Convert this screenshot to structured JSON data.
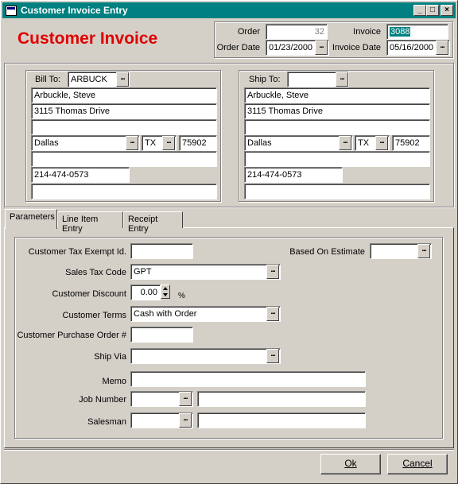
{
  "window": {
    "title": "Customer Invoice Entry"
  },
  "header": {
    "heading": "Customer Invoice",
    "order_label": "Order",
    "order_value": "32",
    "invoice_label": "Invoice",
    "invoice_value": "3088",
    "order_date_label": "Order Date",
    "order_date_value": "01/23/2000",
    "invoice_date_label": "Invoice Date",
    "invoice_date_value": "05/16/2000"
  },
  "bill_to": {
    "label": "Bill To:",
    "code": "ARBUCK",
    "name": "Arbuckle, Steve",
    "address1": "3115 Thomas Drive",
    "address2": "",
    "city": "Dallas",
    "state": "TX",
    "zip": "75902",
    "extra": "",
    "phone": "214-474-0573",
    "extra2": ""
  },
  "ship_to": {
    "label": "Ship To:",
    "code": "",
    "name": "Arbuckle, Steve",
    "address1": "3115 Thomas Drive",
    "address2": "",
    "city": "Dallas",
    "state": "TX",
    "zip": "75902",
    "extra": "",
    "phone": "214-474-0573",
    "extra2": ""
  },
  "tabs": [
    {
      "label": "Parameters"
    },
    {
      "label": "Line Item Entry"
    },
    {
      "label": "Receipt Entry"
    }
  ],
  "params": {
    "tax_exempt_label": "Customer Tax Exempt Id.",
    "tax_exempt_value": "",
    "based_on_estimate_label": "Based On Estimate",
    "based_on_estimate_value": "",
    "sales_tax_label": "Sales Tax Code",
    "sales_tax_value": "GPT",
    "discount_label": "Customer Discount",
    "discount_value": "0.00",
    "discount_unit": "%",
    "terms_label": "Customer Terms",
    "terms_value": "Cash with Order",
    "po_label": "Customer Purchase Order #",
    "po_value": "",
    "ship_via_label": "Ship Via",
    "ship_via_value": "",
    "memo_label": "Memo",
    "memo_value": "",
    "job_label": "Job Number",
    "job_value": "",
    "job_desc": "",
    "salesman_label": "Salesman",
    "salesman_value": "",
    "salesman_desc": ""
  },
  "buttons": {
    "ok": "Ok",
    "cancel": "Cancel"
  },
  "ellipsis": "..."
}
